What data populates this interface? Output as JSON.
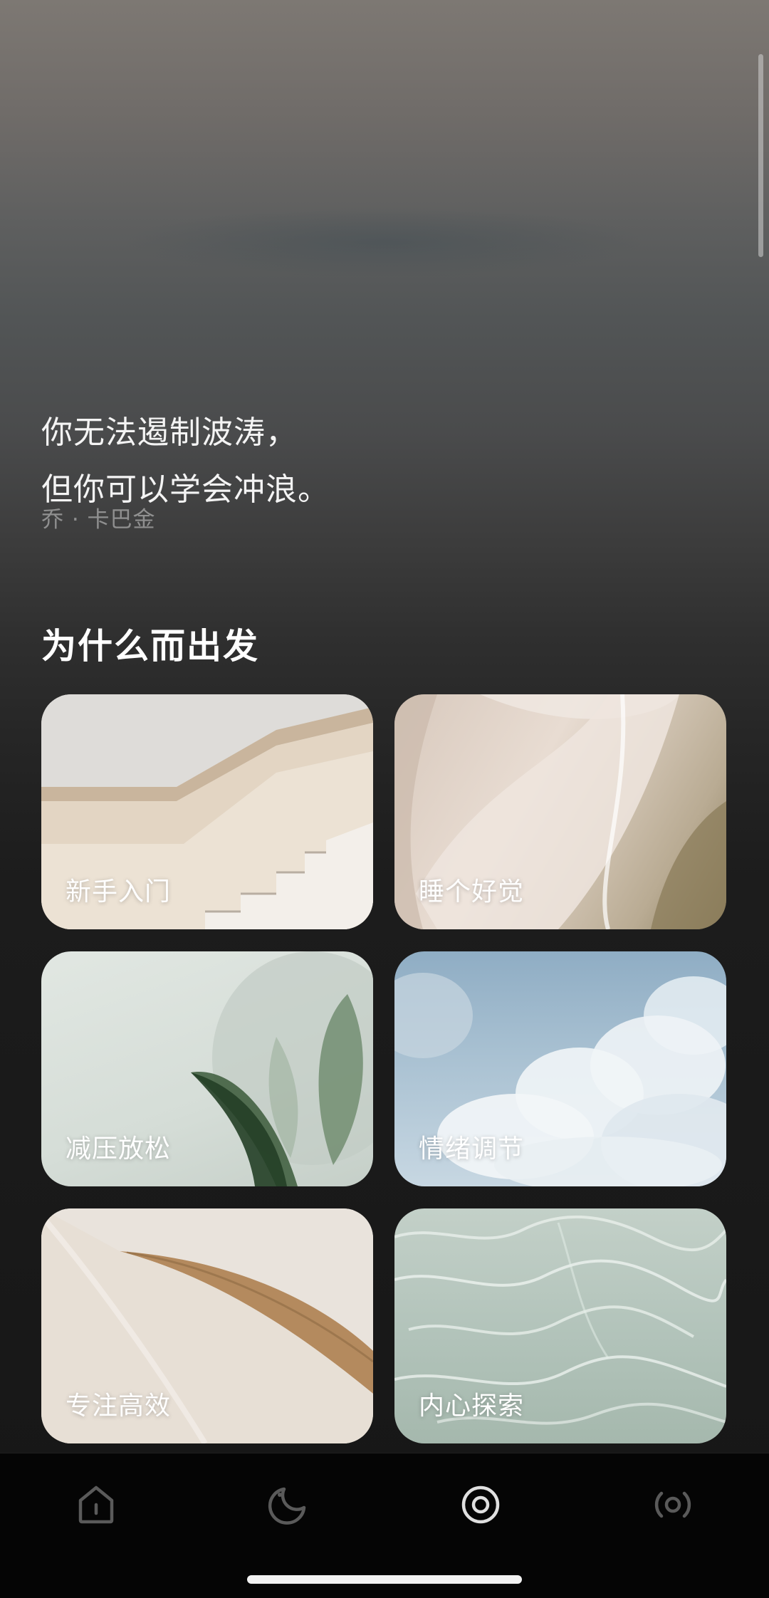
{
  "quote": {
    "line1": "你无法遏制波涛，",
    "line2": "但你可以学会冲浪。",
    "author": "乔 · 卡巴金"
  },
  "section": {
    "title": "为什么而出发"
  },
  "cards": [
    {
      "label": "新手入门"
    },
    {
      "label": "睡个好觉"
    },
    {
      "label": "减压放松"
    },
    {
      "label": "情绪调节"
    },
    {
      "label": "专注高效"
    },
    {
      "label": "内心探索"
    }
  ],
  "tabbar": {
    "items": [
      {
        "icon": "home-icon",
        "active": false
      },
      {
        "icon": "moon-icon",
        "active": false
      },
      {
        "icon": "meditation-target-icon",
        "active": true
      },
      {
        "icon": "broadcast-icon",
        "active": false
      }
    ],
    "colors": {
      "active": "#e0e0e0",
      "inactive": "#5a5a5a"
    }
  }
}
